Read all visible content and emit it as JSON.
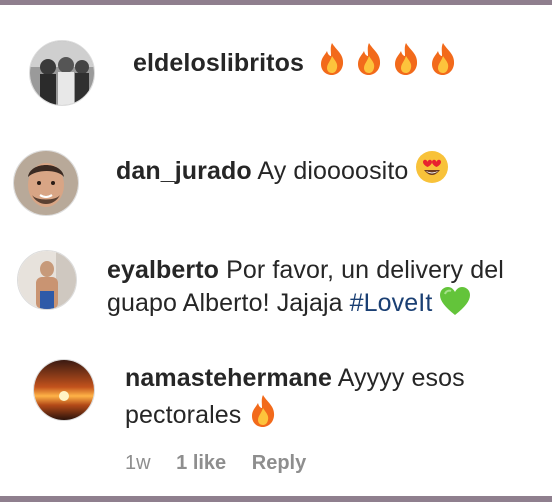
{
  "comments": [
    {
      "username": "eldeloslibritos",
      "text": "",
      "emojis": [
        "fire-emoji",
        "fire-emoji",
        "fire-emoji",
        "fire-emoji"
      ]
    },
    {
      "username": "dan_jurado",
      "text": "Ay dioooosito",
      "emojis": [
        "heart-eyes-emoji"
      ]
    },
    {
      "username": "eyalberto",
      "text_line1": "Por favor, un delivery del",
      "text_line2": "guapo Alberto! Jajaja",
      "hashtag": "#LoveIt",
      "emojis": [
        "green-heart-emoji"
      ]
    },
    {
      "username": "namastehermane",
      "text_line1": "Ayyyy esos",
      "text_line2": "pectorales",
      "emojis": [
        "fire-emoji"
      ]
    }
  ],
  "meta": {
    "age": "1w",
    "likes": "1 like",
    "reply": "Reply"
  },
  "colors": {
    "frame": "#8f7f8e",
    "text": "#262626",
    "meta": "#8e8e8e",
    "hashtag": "#1a3f73"
  }
}
